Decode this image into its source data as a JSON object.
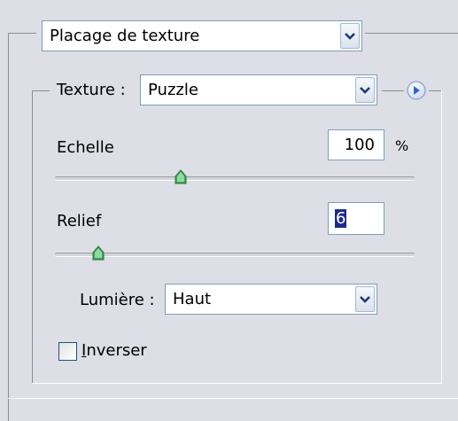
{
  "mapping": {
    "selected": "Placage de texture"
  },
  "texture": {
    "label": "Texture :",
    "selected": "Puzzle"
  },
  "scale": {
    "label": "Echelle",
    "value": "100",
    "unit": "%",
    "level": 0.35
  },
  "relief": {
    "label": "Relief",
    "value": "6",
    "level": 0.12
  },
  "light": {
    "label": "Lumière :",
    "selected": "Haut"
  },
  "invert": {
    "label_underlined": "I",
    "label_rest": "nverser",
    "checked": false
  },
  "colors": {
    "panel_bg": "#dddee6",
    "thumb_green": "#3aa858",
    "play_blue": "#2b66d9"
  },
  "icons": {
    "dropdown": "chevron-down-icon",
    "play": "play-circle-icon"
  }
}
